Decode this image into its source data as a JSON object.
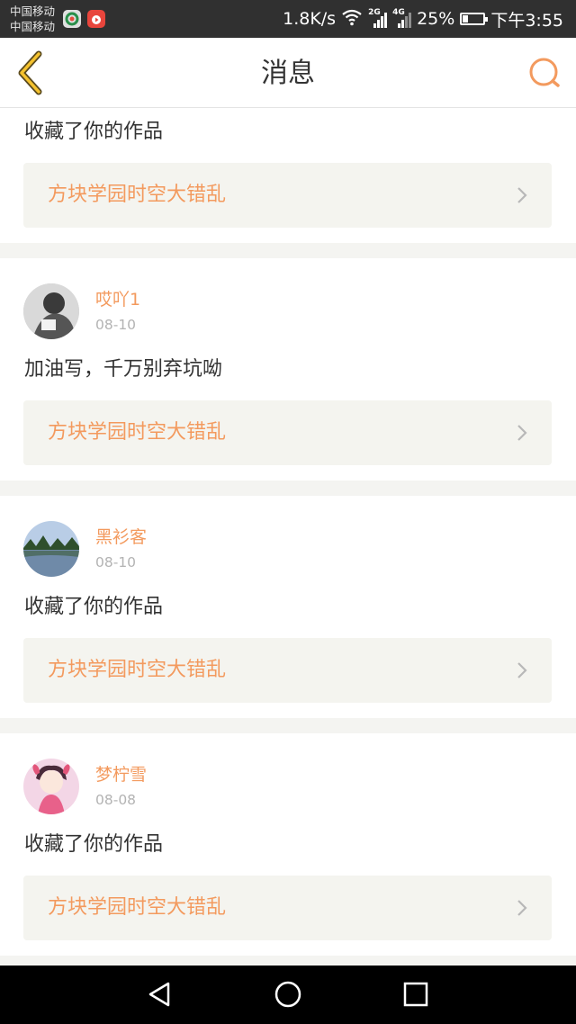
{
  "status_bar": {
    "carrier_1": "中国移动",
    "carrier_2": "中国移动",
    "net_speed": "1.8K/s",
    "sim1_tag": "2G",
    "sim2_tag": "4G",
    "battery_percent": "25%",
    "battery_level": 0.25,
    "time": "下午3:55",
    "app_icons": [
      "browser-app-icon",
      "video-app-icon"
    ]
  },
  "header": {
    "title": "消息",
    "back_icon": "chevron-left-icon",
    "search_icon": "search-icon",
    "accent": "#f39a5e"
  },
  "messages": [
    {
      "user": "",
      "date": "",
      "text": "收藏了你的作品",
      "work_title": "方块学园时空大错乱"
    },
    {
      "user": "哎吖1",
      "date": "08-10",
      "text": "加油写，千万别弃坑呦",
      "work_title": "方块学园时空大错乱",
      "avatar_icon": "avatar-photo"
    },
    {
      "user": "黑衫客",
      "date": "08-10",
      "text": "收藏了你的作品",
      "work_title": "方块学园时空大错乱",
      "avatar_icon": "avatar-landscape"
    },
    {
      "user": "梦柠雪",
      "date": "08-08",
      "text": "收藏了你的作品",
      "work_title": "方块学园时空大错乱",
      "avatar_icon": "avatar-anime"
    }
  ],
  "nav_bar": {
    "buttons": [
      "back-triangle-icon",
      "home-circle-icon",
      "recents-square-icon"
    ]
  }
}
